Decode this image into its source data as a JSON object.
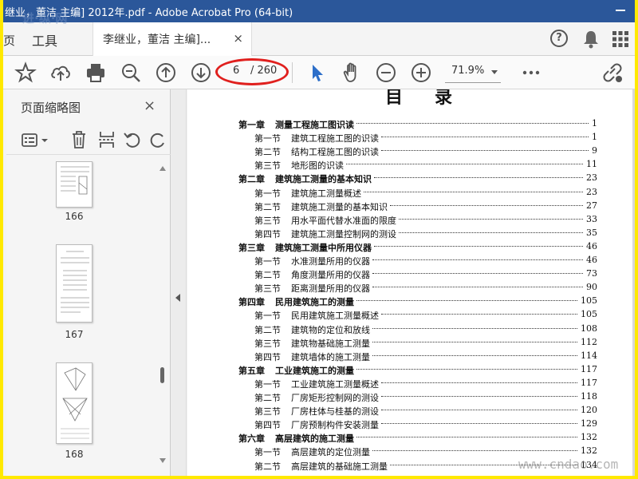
{
  "window": {
    "title": "继业，董洁 主编] 2012年.pdf - Adobe Acrobat Pro (64-bit)",
    "watermark_top": "进·纵·网",
    "watermark_bottom": "www.cndao.com"
  },
  "menubar": {
    "home_tab": "页",
    "tools_tab": "工具",
    "doc_tab": "李继业，董洁 主编]...",
    "doc_tab_close": "×",
    "help": "?"
  },
  "toolbar": {
    "current_page": "6",
    "total_pages": "/ 260",
    "zoom": "71.9%"
  },
  "left_panel": {
    "header": "页面缩略图",
    "close": "×",
    "thumbnails": [
      {
        "label": "166"
      },
      {
        "label": "167"
      },
      {
        "label": "168"
      }
    ]
  },
  "document": {
    "toc_title": "目录",
    "entries": [
      {
        "type": "chapter",
        "lead": "第一章",
        "title": "测量工程施工图识读",
        "page": "1"
      },
      {
        "type": "section",
        "lead": "第一节",
        "title": "建筑工程施工图的识读",
        "page": "1"
      },
      {
        "type": "section",
        "lead": "第二节",
        "title": "结构工程施工图的识读",
        "page": "9"
      },
      {
        "type": "section",
        "lead": "第三节",
        "title": "地形图的识读",
        "page": "11"
      },
      {
        "type": "chapter",
        "lead": "第二章",
        "title": "建筑施工测量的基本知识",
        "page": "23"
      },
      {
        "type": "section",
        "lead": "第一节",
        "title": "建筑施工测量概述",
        "page": "23"
      },
      {
        "type": "section",
        "lead": "第二节",
        "title": "建筑施工测量的基本知识",
        "page": "27"
      },
      {
        "type": "section",
        "lead": "第三节",
        "title": "用水平面代替水准面的限度",
        "page": "33"
      },
      {
        "type": "section",
        "lead": "第四节",
        "title": "建筑施工测量控制网的测设",
        "page": "35"
      },
      {
        "type": "chapter",
        "lead": "第三章",
        "title": "建筑施工测量中所用仪器",
        "page": "46"
      },
      {
        "type": "section",
        "lead": "第一节",
        "title": "水准测量所用的仪器",
        "page": "46"
      },
      {
        "type": "section",
        "lead": "第二节",
        "title": "角度测量所用的仪器",
        "page": "73"
      },
      {
        "type": "section",
        "lead": "第三节",
        "title": "距离测量所用的仪器",
        "page": "90"
      },
      {
        "type": "chapter",
        "lead": "第四章",
        "title": "民用建筑施工的测量",
        "page": "105"
      },
      {
        "type": "section",
        "lead": "第一节",
        "title": "民用建筑施工测量概述",
        "page": "105"
      },
      {
        "type": "section",
        "lead": "第二节",
        "title": "建筑物的定位和放线",
        "page": "108"
      },
      {
        "type": "section",
        "lead": "第三节",
        "title": "建筑物基础施工测量",
        "page": "112"
      },
      {
        "type": "section",
        "lead": "第四节",
        "title": "建筑墙体的施工测量",
        "page": "114"
      },
      {
        "type": "chapter",
        "lead": "第五章",
        "title": "工业建筑施工的测量",
        "page": "117"
      },
      {
        "type": "section",
        "lead": "第一节",
        "title": "工业建筑施工测量概述",
        "page": "117"
      },
      {
        "type": "section",
        "lead": "第二节",
        "title": "厂房矩形控制网的测设",
        "page": "118"
      },
      {
        "type": "section",
        "lead": "第三节",
        "title": "厂房柱体与桂基的测设",
        "page": "120"
      },
      {
        "type": "section",
        "lead": "第四节",
        "title": "厂房预制构件安装测量",
        "page": "129"
      },
      {
        "type": "chapter",
        "lead": "第六章",
        "title": "高层建筑的施工测量",
        "page": "132"
      },
      {
        "type": "section",
        "lead": "第一节",
        "title": "高层建筑的定位测量",
        "page": "132"
      },
      {
        "type": "section",
        "lead": "第二节",
        "title": "高层建筑的基础施工测量",
        "page": "134"
      }
    ]
  }
}
